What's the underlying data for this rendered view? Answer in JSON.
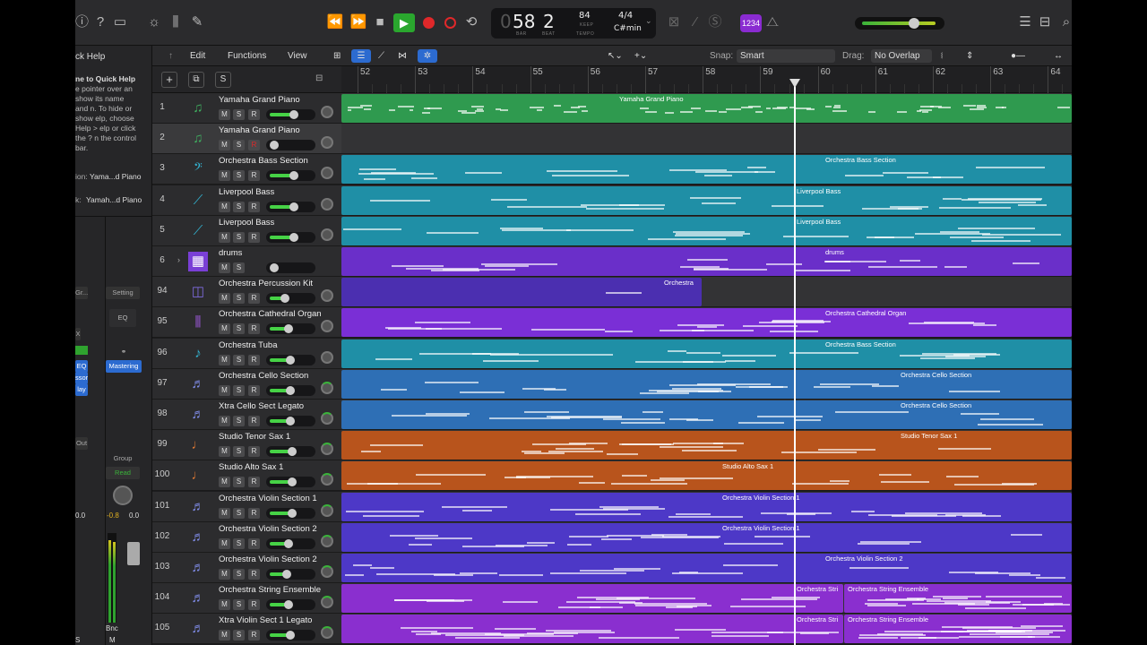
{
  "control_bar": {
    "rewind": "⏪",
    "forward": "⏩",
    "stop": "■",
    "play": "▶",
    "lcd": {
      "bar": "58",
      "beat": "2",
      "bar_label": "BAR",
      "beat_label": "BEAT",
      "tempo": "84",
      "keep": "KEEP",
      "tempo_label": "TEMPO",
      "signature": "4/4",
      "key": "C#min"
    },
    "count_in": "1234"
  },
  "inspector": {
    "title": "ck Help",
    "quick_help_heading": "ne to Quick Help",
    "quick_help_text": "e pointer over an show its name and n. To hide or show elp, choose Help > elp or click the ? n the control bar.",
    "region_label": "ion:",
    "region_value": "Yama...d Piano",
    "track_label": "k:",
    "track_value": "Yamah...d Piano",
    "setting": "Setting",
    "eq": "EQ",
    "gr": "Gr...",
    "x": "X",
    "eq2": "EQ",
    "compressor": "ssor",
    "delay": "lay",
    "mastering": "Mastering",
    "out": "Out",
    "group": "Group",
    "read": "Read",
    "val1": "0.0",
    "val2": "-0.8",
    "val3": "0.0",
    "bnc": "Bnc",
    "m": "M",
    "s": "S"
  },
  "tracks_bar": {
    "edit": "Edit",
    "functions": "Functions",
    "view": "View",
    "snap_label": "Snap:",
    "snap_value": "Smart",
    "drag_label": "Drag:",
    "drag_value": "No Overlap"
  },
  "header": {
    "add": "+",
    "s": "S"
  },
  "ruler": [
    "52",
    "53",
    "54",
    "55",
    "56",
    "57",
    "58",
    "59",
    "60",
    "61",
    "62",
    "63",
    "64"
  ],
  "tracks": [
    {
      "num": "1",
      "name": "Yamaha Grand Piano",
      "icon": "piano-icon",
      "fader": 0.55,
      "region": "Yamaha Grand Piano",
      "color": "#2f9a4f"
    },
    {
      "num": "2",
      "name": "Yamaha Grand Piano",
      "icon": "piano-icon",
      "fader": 0.0,
      "region": "",
      "color": "#3a3a3c"
    },
    {
      "num": "3",
      "name": "Orchestra Bass Section",
      "icon": "bass-icon",
      "fader": 0.55,
      "region": "Orchestra Bass Section",
      "color": "#1f8fa6"
    },
    {
      "num": "4",
      "name": "Liverpool Bass",
      "icon": "guitar-icon",
      "fader": 0.55,
      "region": "Liverpool Bass",
      "color": "#1f8fa6"
    },
    {
      "num": "5",
      "name": "Liverpool Bass",
      "icon": "guitar-icon",
      "fader": 0.55,
      "region": "Liverpool Bass",
      "color": "#1f8fa6"
    },
    {
      "num": "6",
      "name": "drums",
      "icon": "drum-machine-icon",
      "fader": 0.0,
      "region": "drums",
      "color": "#6a2fc9"
    },
    {
      "num": "94",
      "name": "Orchestra Percussion Kit",
      "icon": "percussion-icon",
      "fader": 0.3,
      "region": "Orchestra",
      "color": "#4b2fb0"
    },
    {
      "num": "95",
      "name": "Orchestra Cathedral Organ",
      "icon": "organ-icon",
      "fader": 0.4,
      "region": "Orchestra Cathedral Organ",
      "color": "#7a2fd6"
    },
    {
      "num": "96",
      "name": "Orchestra Tuba",
      "icon": "tuba-icon",
      "fader": 0.45,
      "region": "Orchestra Bass Section",
      "color": "#1f8fa6"
    },
    {
      "num": "97",
      "name": "Orchestra Cello Section",
      "icon": "strings-icon",
      "fader": 0.45,
      "region": "Orchestra Cello Section",
      "color": "#2e6fb5"
    },
    {
      "num": "98",
      "name": "Xtra Cello Sect Legato",
      "icon": "strings-icon",
      "fader": 0.45,
      "region": "Orchestra Cello Section",
      "color": "#2e6fb5"
    },
    {
      "num": "99",
      "name": "Studio Tenor Sax 1",
      "icon": "sax-icon",
      "fader": 0.5,
      "region": "Studio Tenor Sax 1",
      "color": "#b8541c"
    },
    {
      "num": "100",
      "name": "Studio Alto Sax 1",
      "icon": "sax-icon",
      "fader": 0.5,
      "region": "Studio Alto Sax 1",
      "color": "#b8541c"
    },
    {
      "num": "101",
      "name": "Orchestra Violin Section 1",
      "icon": "strings-icon",
      "fader": 0.5,
      "region": "Orchestra Violin Section 1",
      "color": "#4d38c7"
    },
    {
      "num": "102",
      "name": "Orchestra Violin Section 2",
      "icon": "strings-icon",
      "fader": 0.4,
      "region": "Orchestra Violin Section 1",
      "color": "#4d38c7"
    },
    {
      "num": "103",
      "name": "Orchestra Violin Section 2",
      "icon": "strings-icon",
      "fader": 0.35,
      "region": "Orchestra Violin Section 2",
      "color": "#4d38c7"
    },
    {
      "num": "104",
      "name": "Orchestra String Ensemble",
      "icon": "strings-icon",
      "fader": 0.4,
      "region": "Orchestra String Ensemble",
      "region_b": "Orchestra Stri",
      "color": "#8a2fcf"
    },
    {
      "num": "105",
      "name": "Xtra Violin Sect 1 Legato",
      "icon": "strings-icon",
      "fader": 0.45,
      "region": "Orchestra String Ensemble",
      "region_b": "Orchestra Stri",
      "color": "#8a2fcf"
    }
  ]
}
